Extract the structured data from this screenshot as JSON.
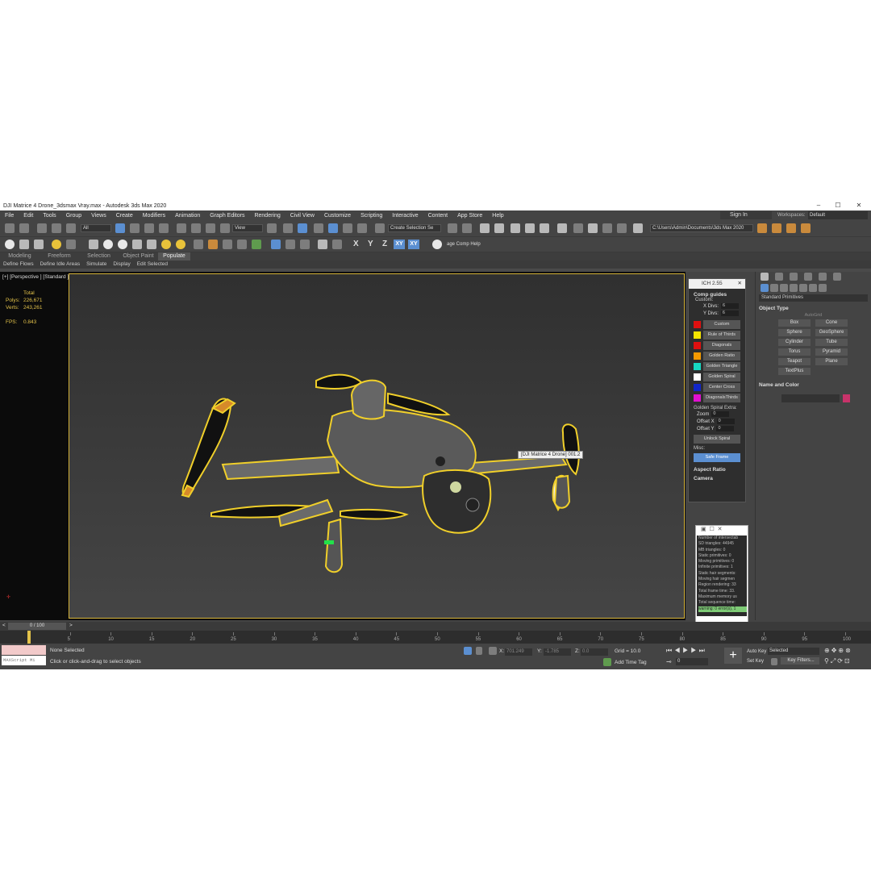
{
  "window": {
    "title": "DJI Matrice 4 Drone_3dsmax Vray.max - Autodesk 3ds Max 2020",
    "minimize": "–",
    "maximize": "☐",
    "close": "✕"
  },
  "menu": [
    "File",
    "Edit",
    "Tools",
    "Group",
    "Views",
    "Create",
    "Modifiers",
    "Animation",
    "Graph Editors",
    "Rendering",
    "Civil View",
    "Customize",
    "Scripting",
    "Interactive",
    "Content",
    "App Store",
    "Help"
  ],
  "signin": "Sign In",
  "workspaces_label": "Workspaces:",
  "workspaces_value": "Default",
  "toolbar": {
    "filter": "All",
    "view": "View",
    "selection_set": "Create Selection Se",
    "path": "C:\\Users\\Admin\\Documents\\3ds Max 2020",
    "comp_helper": "age Comp Help",
    "x": "X",
    "y": "Y",
    "z": "Z",
    "xy1": "XY",
    "xy2": "XY"
  },
  "ribbon_tabs": [
    "Modeling",
    "Freeform",
    "Selection",
    "Object Paint",
    "Populate"
  ],
  "ribbon_sub": [
    "Define Flows",
    "Define Idle Areas",
    "Simulate",
    "Display",
    "Edit Selected"
  ],
  "viewport": {
    "label": "[+] [Perspective ] [Standard ] [Default Shading ]",
    "stats_header": "Total",
    "polys_label": "Polys:",
    "polys": "226,671",
    "verts_label": "Verts:",
    "verts": "243,261",
    "fps_label": "FPS:",
    "fps": "0.843",
    "tooltip": "[DJI Matrice 4 Drone] 001.2"
  },
  "ich": {
    "title": "ICH 2.55",
    "comp_guides": "Comp guides",
    "custom_label": "Custom:",
    "xdivs_label": "X Divs:",
    "xdivs": "6",
    "ydivs_label": "Y Divs:",
    "ydivs": "6",
    "guides": [
      {
        "label": "Custom",
        "color": "#e01010"
      },
      {
        "label": "Rule of Thirds",
        "color": "#f5e400"
      },
      {
        "label": "Diagonals",
        "color": "#e01010"
      },
      {
        "label": "Golden Ratio",
        "color": "#f59a00"
      },
      {
        "label": "Golden Triangle",
        "color": "#17d9c1"
      },
      {
        "label": "Golden Spiral",
        "color": "#ffffff"
      },
      {
        "label": "Center Cross",
        "color": "#1226c9"
      },
      {
        "label": "DiagonalsThirds",
        "color": "#e010d0"
      }
    ],
    "spiral_extra": "Golden Spiral Extra:",
    "zoom_label": "Zoom",
    "zoom": "0",
    "offx_label": "Offset X",
    "offx": "0",
    "offy_label": "Offset Y",
    "offy": "0",
    "unlock": "Unlock Spiral",
    "misc": "Misc:",
    "safe_frame": "Safe Frame",
    "aspect_ratio": "Aspect Ratio",
    "camera": "Camera"
  },
  "render_msgs": [
    "Number of intersectab",
    "SD triangles: 44945",
    "MB triangles: 0",
    "Static primitives: 0",
    "Moving primitives: 0",
    "Infinite primitives: 1",
    "Static hair segments:",
    "Moving hair segmen",
    "Region rendering: 33",
    "Total frame time: 33.",
    "Maximum memory us",
    "Total sequence time:",
    "warning: 0 error(s), 1"
  ],
  "command_panel": {
    "category": "Standard Primitives",
    "object_type": "Object Type",
    "autogrid": "AutoGrid",
    "objects": [
      "Box",
      "Cone",
      "Sphere",
      "GeoSphere",
      "Cylinder",
      "Tube",
      "Torus",
      "Pyramid",
      "Teapot",
      "Plane",
      "TextPlus"
    ],
    "name_color": "Name and Color"
  },
  "timeline": {
    "slider": "0 / 100",
    "ticks": [
      "0",
      "5",
      "10",
      "15",
      "20",
      "25",
      "30",
      "35",
      "40",
      "45",
      "50",
      "55",
      "60",
      "65",
      "70",
      "75",
      "80",
      "85",
      "90",
      "95",
      "100"
    ]
  },
  "status": {
    "selection": "None Selected",
    "prompt": "Click or click-and-drag to select objects",
    "maxscript": "MAXScript Mi",
    "x_label": "X:",
    "x": "701.249",
    "y_label": "Y:",
    "y": "-1.785",
    "z_label": "Z:",
    "z": "0.0",
    "grid": "Grid = 10.0",
    "add_time_tag": "Add Time Tag",
    "auto_key": "Auto Key",
    "selected": "Selected",
    "set_key": "Set Key",
    "key_filters": "Key Filters...",
    "frame": "0"
  }
}
